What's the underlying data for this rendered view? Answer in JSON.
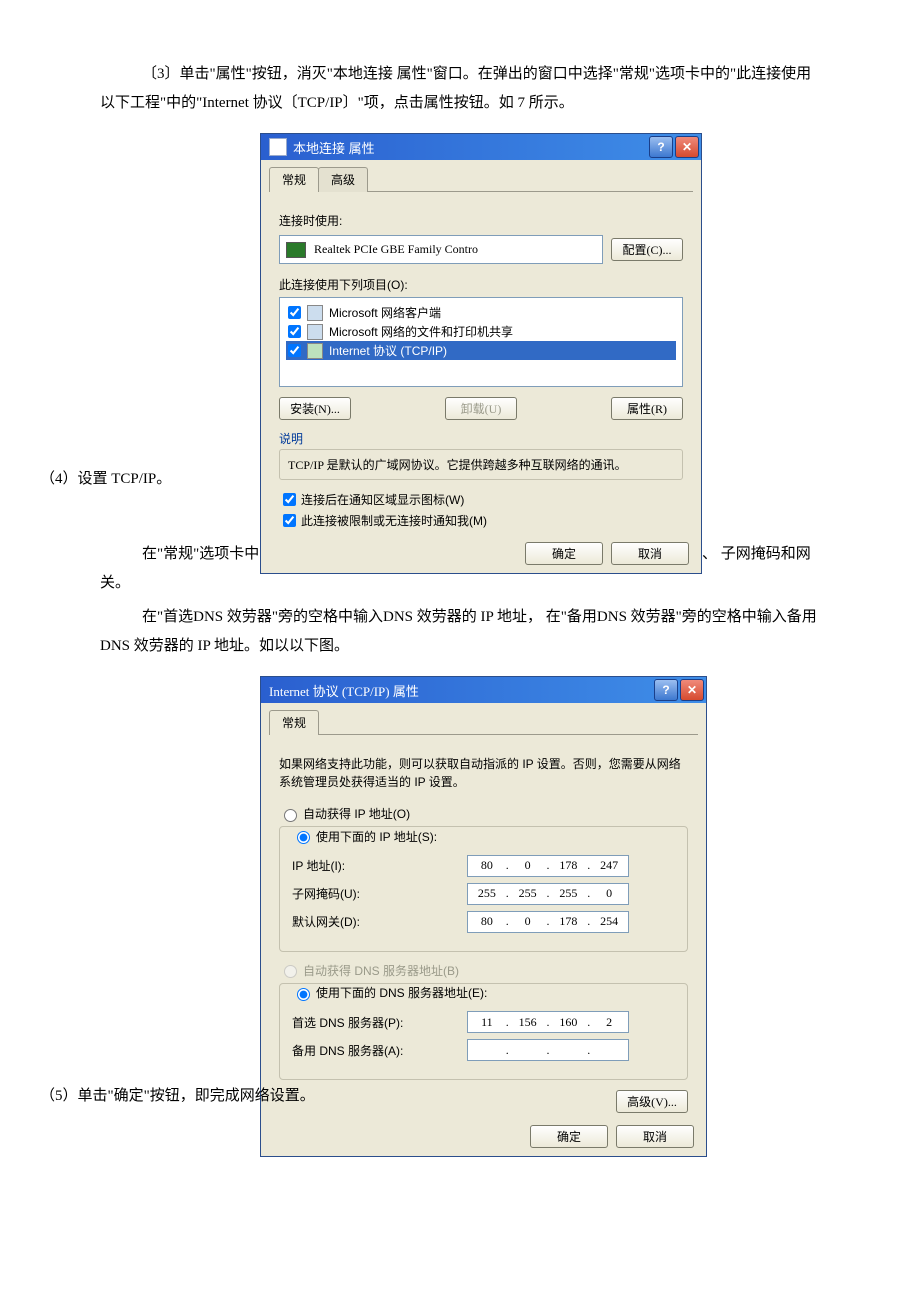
{
  "para1": "〔3〕单击\"属性\"按钮，消灭\"本地连接 属性\"窗口。在弹出的窗口中选择\"常规\"选项卡中的\"此连接使用以下工程\"中的\"Internet 协议〔TCP/IP〕\"项，点击属性按钮。如 7 所示。",
  "overlay_step4": "（4）设置 TCP/IP。",
  "para2a": "在\"常规\"选项卡中，选择\"使用下面的 IP 地址\"，输入你从网络治理员处得到的 IP 地址、 子网掩码和网关。",
  "para3": "在\"首选DNS 效劳器\"旁的空格中输入DNS 效劳器的 IP 地址， 在\"备用DNS 效劳器\"旁的空格中输入备用 DNS 效劳器的 IP 地址。如以以下图。",
  "step5": "（5）单击\"确定\"按钮，即完成网络设置。",
  "dlg1": {
    "title": "本地连接 属性",
    "tabs": {
      "general": "常规",
      "adv": "高级"
    },
    "connectUsing": "连接时使用:",
    "adapter": "Realtek PCIe GBE Family Contro",
    "configure": "配置(C)...",
    "itemsLabel": "此连接使用下列项目(O):",
    "items": [
      "Microsoft 网络客户端",
      "Microsoft 网络的文件和打印机共享",
      "Internet 协议 (TCP/IP)"
    ],
    "install": "安装(N)...",
    "uninstall": "卸载(U)",
    "properties": "属性(R)",
    "descTitle": "说明",
    "desc": "TCP/IP 是默认的广域网协议。它提供跨越多种互联网络的通讯。",
    "showIcon": "连接后在通知区域显示图标(W)",
    "notify": "此连接被限制或无连接时通知我(M)",
    "ok": "确定",
    "cancel": "取消"
  },
  "dlg2": {
    "title": "Internet 协议 (TCP/IP) 属性",
    "tab": "常规",
    "intro": "如果网络支持此功能，则可以获取自动指派的 IP 设置。否则，您需要从网络系统管理员处获得适当的 IP 设置。",
    "autoIp": "自动获得 IP 地址(O)",
    "useIp": "使用下面的 IP 地址(S):",
    "ipLabel": "IP 地址(I):",
    "maskLabel": "子网掩码(U):",
    "gwLabel": "默认网关(D):",
    "ip": [
      "80",
      "0",
      "178",
      "247"
    ],
    "mask": [
      "255",
      "255",
      "255",
      "0"
    ],
    "gw": [
      "80",
      "0",
      "178",
      "254"
    ],
    "autoDns": "自动获得 DNS 服务器地址(B)",
    "useDns": "使用下面的 DNS 服务器地址(E):",
    "pdnsLabel": "首选 DNS 服务器(P):",
    "adnsLabel": "备用 DNS 服务器(A):",
    "pdns": [
      "11",
      "156",
      "160",
      "2"
    ],
    "adns": [
      "",
      "",
      "",
      ""
    ],
    "advanced": "高级(V)...",
    "ok": "确定",
    "cancel": "取消"
  }
}
